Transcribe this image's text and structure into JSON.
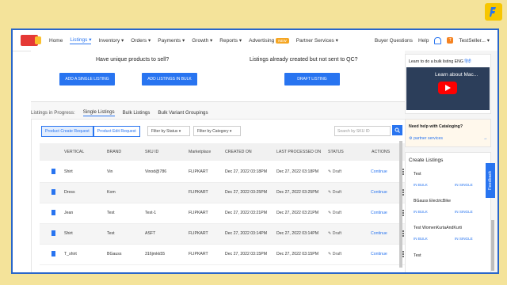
{
  "nav": {
    "items": [
      "Home",
      "Listings",
      "Inventory",
      "Orders",
      "Payments",
      "Growth",
      "Reports",
      "Advertising",
      "Partner Services"
    ],
    "new_badge": "NEW",
    "right": [
      "Buyer Questions",
      "Help",
      "TestSeller..."
    ]
  },
  "upper": {
    "unique_heading": "Have unique products to sell?",
    "qc_heading": "Listings already created but not sent to QC?",
    "add_single": "ADD A SINGLE LISTING",
    "add_bulk": "ADD LISTINGS IN BULK",
    "draft_listing": "DRAFT LISTING"
  },
  "tabs": {
    "label": "Listings in Progress:",
    "items": [
      "Single Listings",
      "Bulk Listings",
      "Bulk Variant Groupings"
    ]
  },
  "toolbar": {
    "seg": [
      "Product Create Request",
      "Product Edit Request"
    ],
    "filter_status": "Filter by Status",
    "filter_category": "Filter by Category",
    "search_placeholder": "Search by SKU ID"
  },
  "table": {
    "headers": [
      "VERTICAL",
      "BRAND",
      "SKU ID",
      "Marketplace",
      "CREATED ON",
      "LAST PROCESSED ON",
      "STATUS",
      "ACTIONS"
    ],
    "rows": [
      {
        "vertical": "Shirt",
        "brand": "Vin",
        "sku": "Vinod@786",
        "market": "FLIPKART",
        "created": "Dec 27, 2022 03:18PM",
        "processed": "Dec 27, 2022 03:18PM",
        "status": "Draft",
        "action": "Continue"
      },
      {
        "vertical": "Dress",
        "brand": "Kom",
        "sku": "",
        "market": "FLIPKART",
        "created": "Dec 27, 2022 03:25PM",
        "processed": "Dec 27, 2022 03:25PM",
        "status": "Draft",
        "action": "Continue"
      },
      {
        "vertical": "Jean",
        "brand": "Test",
        "sku": "Test-1",
        "market": "FLIPKART",
        "created": "Dec 27, 2022 03:21PM",
        "processed": "Dec 27, 2022 03:21PM",
        "status": "Draft",
        "action": "Continue"
      },
      {
        "vertical": "Shirt",
        "brand": "Test",
        "sku": "ASFT",
        "market": "FLIPKART",
        "created": "Dec 27, 2022 03:14PM",
        "processed": "Dec 27, 2022 03:14PM",
        "status": "Draft",
        "action": "Continue"
      },
      {
        "vertical": "T_shirt",
        "brand": "BGauss",
        "sku": "316jmkk55",
        "market": "FLIPKART",
        "created": "Dec 27, 2022 03:15PM",
        "processed": "Dec 27, 2022 03:15PM",
        "status": "Draft",
        "action": "Continue"
      }
    ]
  },
  "side": {
    "video_caption": "Learn to do a bulk listing ENG",
    "video_lang": "हिंदी",
    "video_title": "Learn about Mac...",
    "help_title": "Need help with Cataloging?",
    "partner": "partner services",
    "create_title": "Create Listings",
    "items": [
      {
        "name": "Test",
        "bulk": "IN BULK",
        "single": "IN SINGLE"
      },
      {
        "name": "BGauss ElectricBike",
        "bulk": "IN BULK",
        "single": "IN SINGLE"
      },
      {
        "name": "Test WomenKurtaAndKurti",
        "bulk": "IN BULK",
        "single": "IN SINGLE"
      },
      {
        "name": "Test",
        "bulk": "",
        "single": ""
      }
    ]
  },
  "feedback": "Feedback",
  "colors": {
    "accent": "#2874f0",
    "frame": "#2a66c9",
    "background": "#f4e39a"
  }
}
